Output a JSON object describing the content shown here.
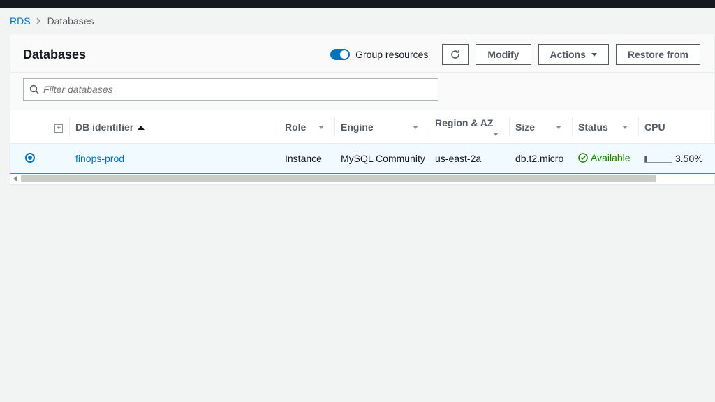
{
  "breadcrumb": {
    "root": "RDS",
    "current": "Databases"
  },
  "header": {
    "title": "Databases",
    "group_resources_label": "Group resources",
    "modify_label": "Modify",
    "actions_label": "Actions",
    "restore_label": "Restore from"
  },
  "filter": {
    "placeholder": "Filter databases"
  },
  "columns": {
    "db_identifier": "DB identifier",
    "role": "Role",
    "engine": "Engine",
    "region_az": "Region & AZ",
    "size": "Size",
    "status": "Status",
    "cpu": "CPU"
  },
  "rows": [
    {
      "selected": true,
      "db_identifier": "finops-prod",
      "role": "Instance",
      "engine": "MySQL Community",
      "region_az": "us-east-2a",
      "size": "db.t2.micro",
      "status": "Available",
      "cpu": "3.50%"
    }
  ]
}
